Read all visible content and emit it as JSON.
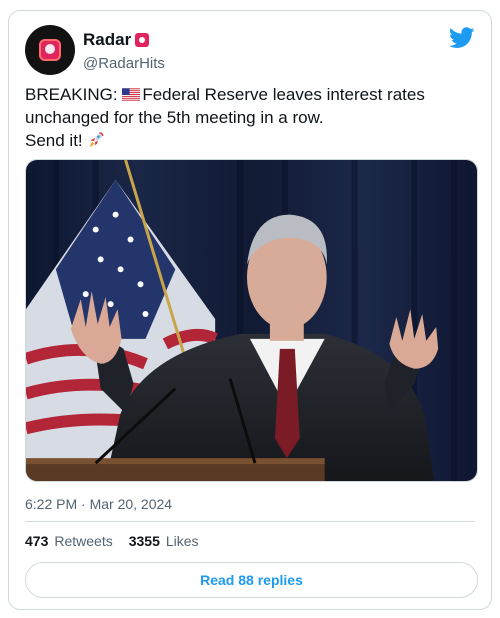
{
  "tweet": {
    "author_name": "Radar",
    "author_handle": "@RadarHits",
    "text_line1": "BREAKING: ",
    "text_line1b": "Federal Reserve leaves interest rates",
    "text_line2": "unchanged for the 5th meeting in a row.",
    "text_line3": "Send it! ",
    "timestamp": "6:22 PM · Mar 20, 2024",
    "retweets": "473",
    "retweets_label": "Retweets",
    "likes": "3355",
    "likes_label": "Likes",
    "replies_button": "Read 88 replies"
  },
  "colors": {
    "accent": "#1d9bf0",
    "border": "#cfd9de",
    "muted": "#536471"
  },
  "icons": {
    "brand": "twitter-bird-icon",
    "flag": "us-flag-icon",
    "rocket": "rocket-icon",
    "avatar_badge": "siren-icon"
  }
}
